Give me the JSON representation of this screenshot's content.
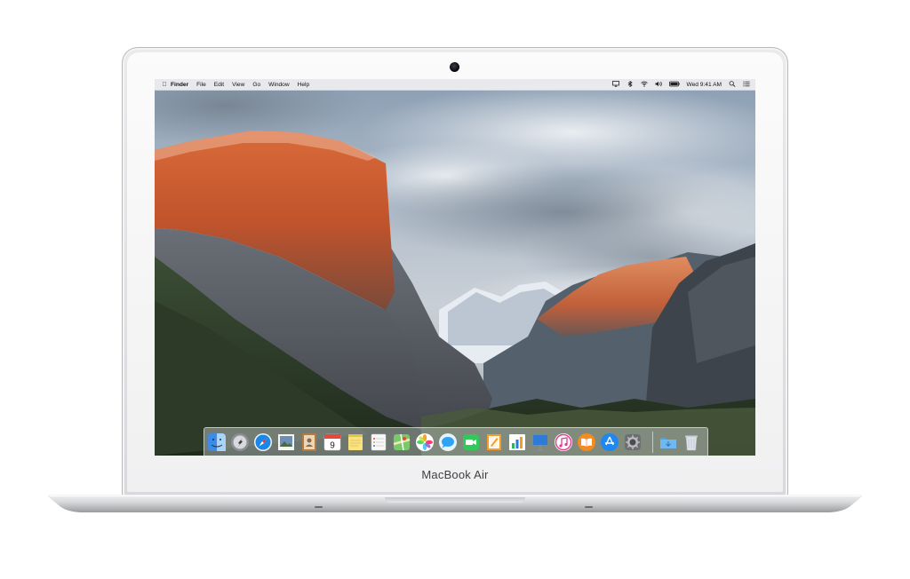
{
  "device": {
    "brand_label": "MacBook Air",
    "colors": {
      "aluminum": "#e2e3e5",
      "bezel": "#f6f6f7",
      "camera": "#0b0c10"
    }
  },
  "menubar": {
    "apple_icon": "apple-logo-icon",
    "app_name": "Finder",
    "menus": [
      "File",
      "Edit",
      "View",
      "Go",
      "Window",
      "Help"
    ],
    "status_icons": [
      "screen-mirroring-icon",
      "bluetooth-icon",
      "wifi-icon",
      "volume-icon",
      "battery-icon"
    ],
    "clock": "Wed 9:41 AM",
    "extra_icons": [
      "spotlight-icon",
      "notification-center-icon"
    ]
  },
  "dock": {
    "apps": [
      {
        "name": "finder-icon",
        "color": "#3c8ce7"
      },
      {
        "name": "launchpad-icon",
        "color": "#8c8f95"
      },
      {
        "name": "safari-icon",
        "color": "#1a86e8"
      },
      {
        "name": "photo-browser-icon",
        "color": "#6e8fb5"
      },
      {
        "name": "contacts-icon",
        "color": "#b57a3e"
      },
      {
        "name": "calendar-icon",
        "color": "#ffffff",
        "text": "9"
      },
      {
        "name": "notes-icon",
        "color": "#fbe27c"
      },
      {
        "name": "reminders-icon",
        "color": "#f7f7f7"
      },
      {
        "name": "maps-icon",
        "color": "#79c96a"
      },
      {
        "name": "photos-icon",
        "color": "#f5a623"
      },
      {
        "name": "messages-icon",
        "color": "#2ea3f6"
      },
      {
        "name": "facetime-icon",
        "color": "#34c759"
      },
      {
        "name": "pages-icon",
        "color": "#f39b2b"
      },
      {
        "name": "numbers-icon",
        "color": "#2fb25a"
      },
      {
        "name": "keynote-icon",
        "color": "#2f7ad9"
      },
      {
        "name": "itunes-icon",
        "color": "#e7388e"
      },
      {
        "name": "ibooks-icon",
        "color": "#f58a1f"
      },
      {
        "name": "app-store-icon",
        "color": "#1e88f0"
      },
      {
        "name": "system-preferences-icon",
        "color": "#6d6e72"
      },
      {
        "name": "downloads-folder-icon",
        "color": "#4aa4e8"
      },
      {
        "name": "trash-icon",
        "color": "#dfe4ea"
      }
    ]
  }
}
